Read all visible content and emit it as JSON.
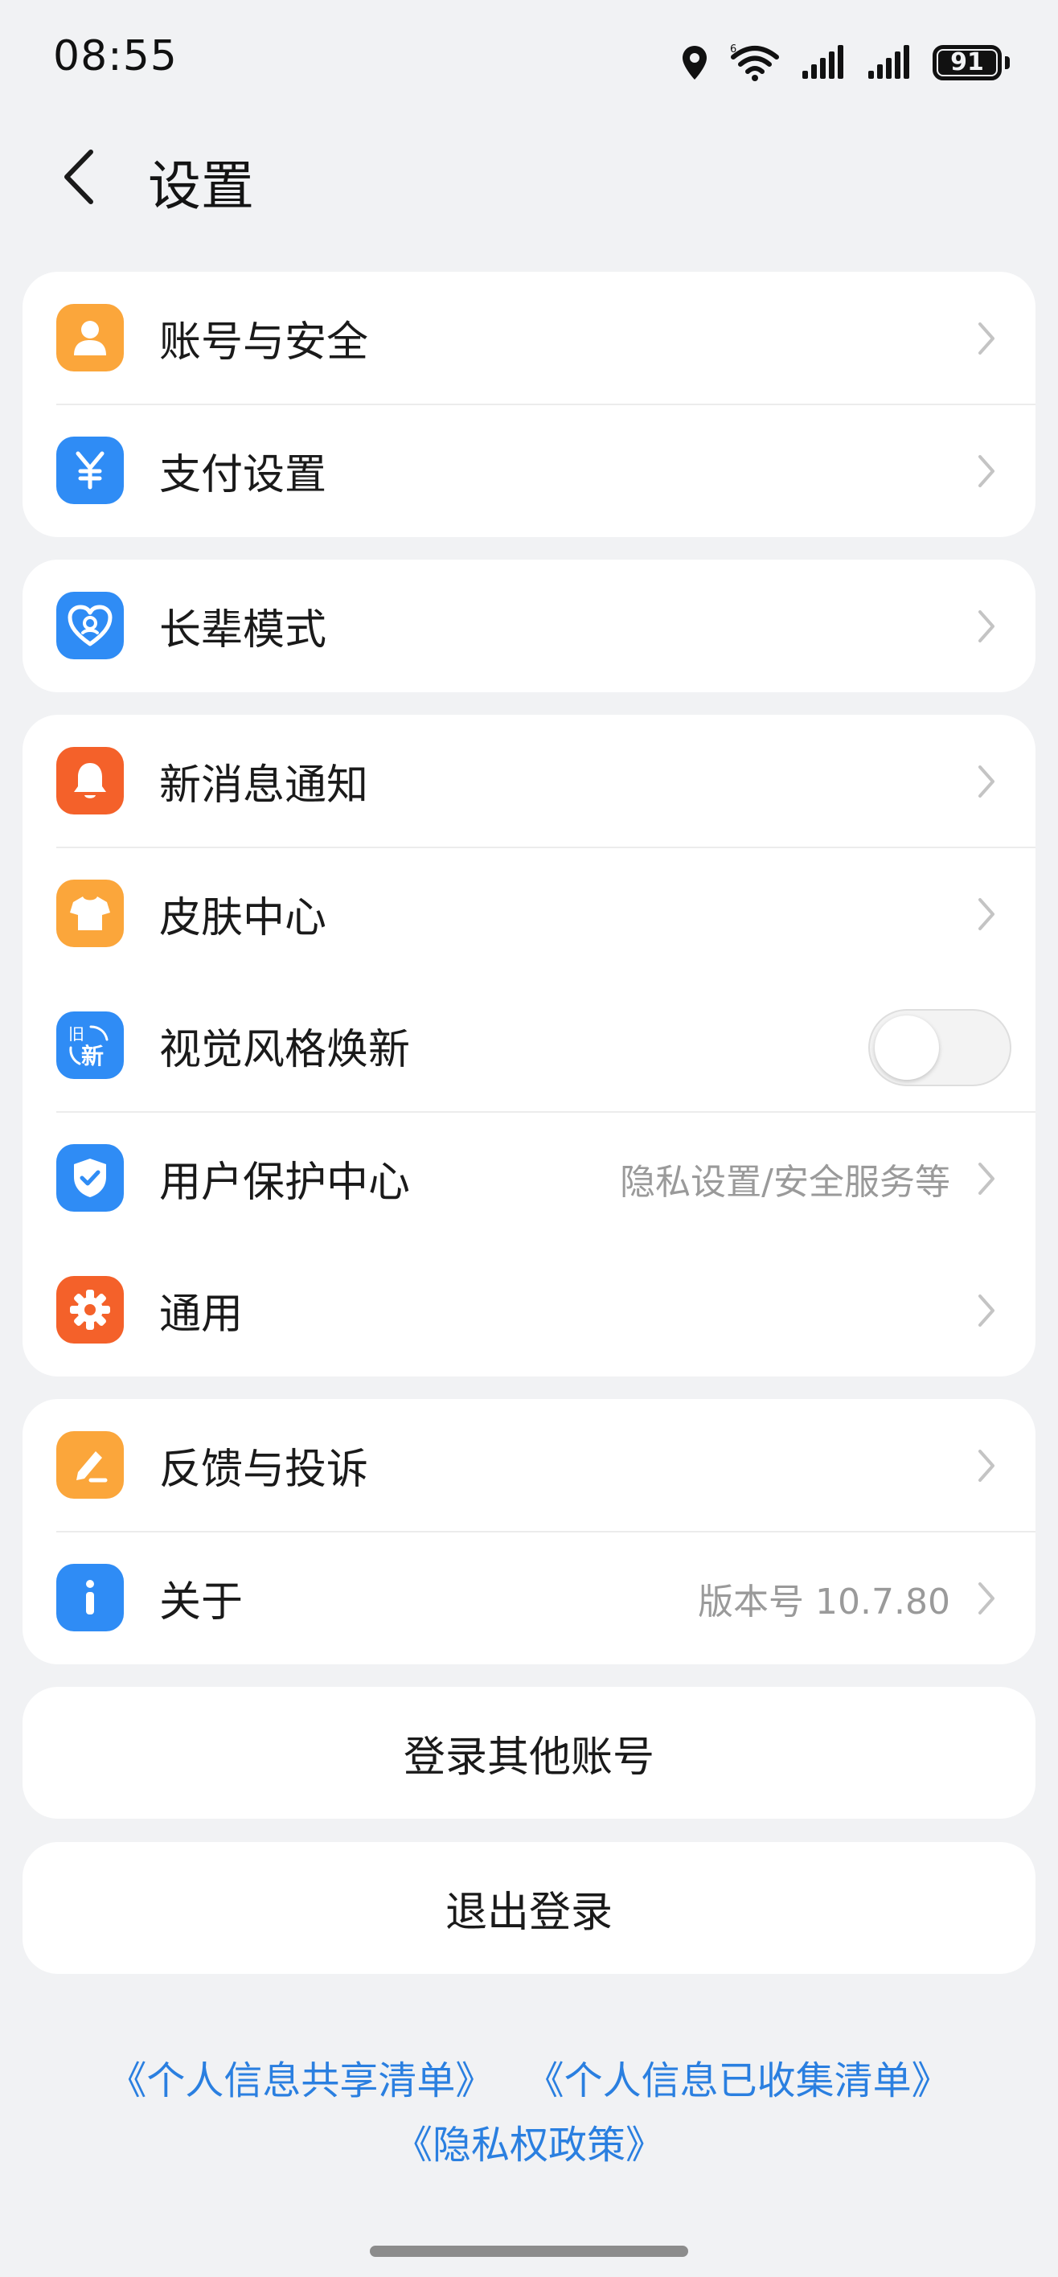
{
  "status_bar": {
    "time": "08:55",
    "battery": "91",
    "icons": [
      "location-icon",
      "wifi-icon",
      "signal-icon",
      "signal-icon",
      "battery-icon"
    ]
  },
  "header": {
    "back_icon": "chevron-left-icon",
    "title": "设置"
  },
  "groups": [
    {
      "items": [
        {
          "label": "账号与安全",
          "icon": "person-icon",
          "color": "#fba63b"
        },
        {
          "label": "支付设置",
          "icon": "yen-icon",
          "color": "#2f8cf5"
        }
      ]
    },
    {
      "items": [
        {
          "label": "长辈模式",
          "icon": "heart-icon",
          "color": "#2f8cf5"
        }
      ]
    },
    {
      "items": [
        {
          "label": "新消息通知",
          "icon": "bell-icon",
          "color": "#f4612a"
        },
        {
          "label": "皮肤中心",
          "icon": "shirt-icon",
          "color": "#fba63b"
        },
        {
          "label": "视觉风格焕新",
          "icon": "refresh-new-icon",
          "icon_text_top": "旧",
          "icon_text_bottom": "新",
          "color": "#2f8cf5",
          "toggle": "off"
        },
        {
          "label": "用户保护中心",
          "value": "隐私设置/安全服务等",
          "icon": "shield-check-icon",
          "color": "#2f8cf5"
        },
        {
          "label": "通用",
          "icon": "gear-icon",
          "color": "#f4612a"
        }
      ]
    },
    {
      "items": [
        {
          "label": "反馈与投诉",
          "icon": "pen-icon",
          "color": "#fba63b"
        },
        {
          "label": "关于",
          "value": "版本号 10.7.80",
          "icon": "info-icon",
          "color": "#2f8cf5"
        }
      ]
    }
  ],
  "actions": {
    "switch_account": "登录其他账号",
    "logout": "退出登录"
  },
  "footer_links": [
    "《个人信息共享清单》",
    "《个人信息已收集清单》",
    "《隐私权政策》"
  ],
  "colors": {
    "background": "#f1f2f4",
    "link": "#2a7fe0",
    "orange": "#fba63b",
    "blue": "#2f8cf5",
    "red_orange": "#f4612a"
  }
}
